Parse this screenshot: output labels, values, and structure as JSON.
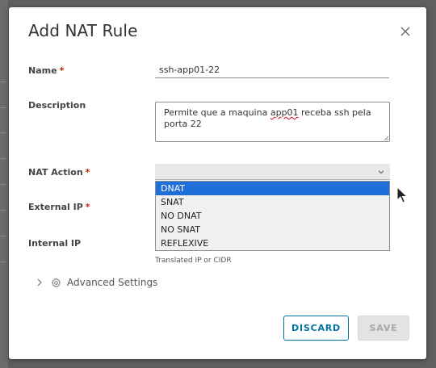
{
  "dialog": {
    "title": "Add NAT Rule",
    "close_icon": "close-icon"
  },
  "form": {
    "name": {
      "label": "Name",
      "required_mark": "*",
      "value": "ssh-app01-22"
    },
    "description": {
      "label": "Description",
      "value_part1": "Permite que a maquina ",
      "value_misspelled": "app01",
      "value_part2": " receba ssh pela porta 22"
    },
    "nat_action": {
      "label": "NAT Action",
      "required_mark": "*",
      "selected": "DNAT",
      "options": [
        "DNAT",
        "SNAT",
        "NO DNAT",
        "NO SNAT",
        "REFLEXIVE"
      ]
    },
    "external_ip": {
      "label": "External IP",
      "required_mark": "*"
    },
    "internal_ip": {
      "label": "Internal IP",
      "helper": "Translated IP or CIDR"
    },
    "advanced": {
      "label": "Advanced Settings",
      "icon": "gear-icon"
    }
  },
  "buttons": {
    "discard": "DISCARD",
    "save": "SAVE"
  },
  "colors": {
    "accent": "#0072a3",
    "required": "#c92100",
    "selected_option": "#1e6fd9"
  }
}
